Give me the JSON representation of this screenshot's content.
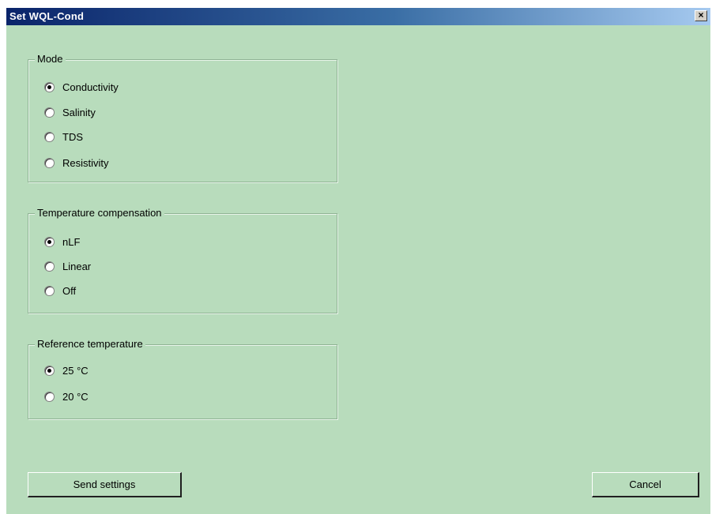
{
  "window": {
    "title": "Set WQL-Cond",
    "close_glyph": "×"
  },
  "mode_group": {
    "title": "Mode",
    "options": [
      {
        "label": "Conductivity",
        "selected": true
      },
      {
        "label": "Salinity",
        "selected": false
      },
      {
        "label": "TDS",
        "selected": false
      },
      {
        "label": "Resistivity",
        "selected": false
      }
    ]
  },
  "temp_comp_group": {
    "title": "Temperature compensation",
    "options": [
      {
        "label": "nLF",
        "selected": true
      },
      {
        "label": "Linear",
        "selected": false
      },
      {
        "label": "Off",
        "selected": false
      }
    ]
  },
  "ref_temp_group": {
    "title": "Reference temperature",
    "options": [
      {
        "label": "25 °C",
        "selected": true
      },
      {
        "label": "20 °C",
        "selected": false
      }
    ]
  },
  "buttons": {
    "send_label": "Send settings",
    "cancel_label": "Cancel"
  },
  "colors": {
    "dialog_background": "#b8dcbc",
    "titlebar_start": "#0a246a",
    "titlebar_end": "#a6caf0"
  }
}
